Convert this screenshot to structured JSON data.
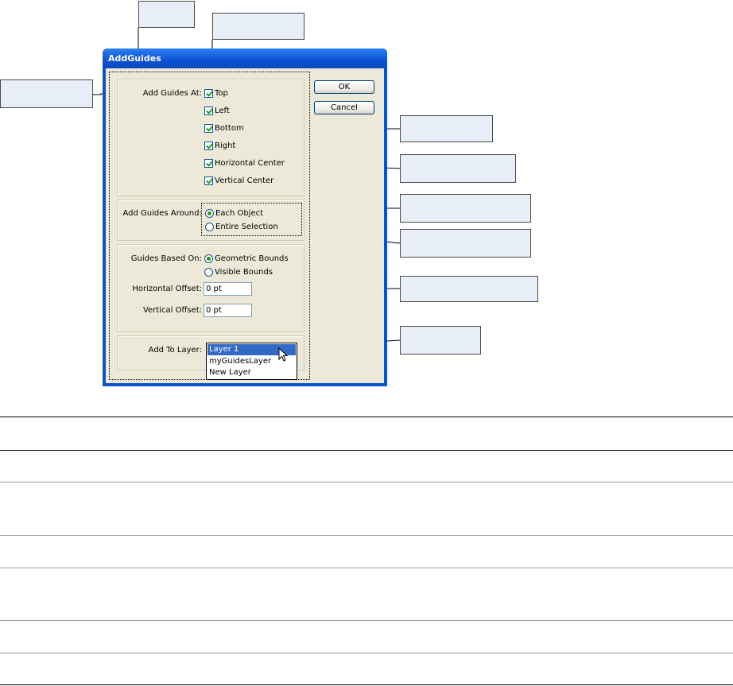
{
  "dialog": {
    "title": "AddGuides",
    "ok_label": "OK",
    "cancel_label": "Cancel",
    "add_guides_at": {
      "label": "Add Guides At:",
      "options": [
        "Top",
        "Left",
        "Bottom",
        "Right",
        "Horizontal Center",
        "Vertical Center"
      ]
    },
    "add_guides_around": {
      "label": "Add Guides Around:",
      "options": [
        "Each Object",
        "Entire Selection"
      ],
      "selected": "Each Object"
    },
    "guides_based_on": {
      "label": "Guides Based On:",
      "options": [
        "Geometric Bounds",
        "Visible Bounds"
      ],
      "selected": "Geometric Bounds"
    },
    "horizontal_offset": {
      "label": "Horizontal Offset:",
      "value": "0 pt"
    },
    "vertical_offset": {
      "label": "Vertical Offset:",
      "value": "0 pt"
    },
    "add_to_layer": {
      "label": "Add To Layer:",
      "options": [
        "Layer 1",
        "myGuidesLayer",
        "New Layer"
      ],
      "selected": "Layer 1"
    }
  },
  "colors": {
    "callout_fill": "#e8eef7",
    "titlebar_blue": "#0d55d6",
    "dialog_face": "#ece9d8",
    "checkmark_green": "#21a121",
    "selection_blue": "#316ac5"
  }
}
